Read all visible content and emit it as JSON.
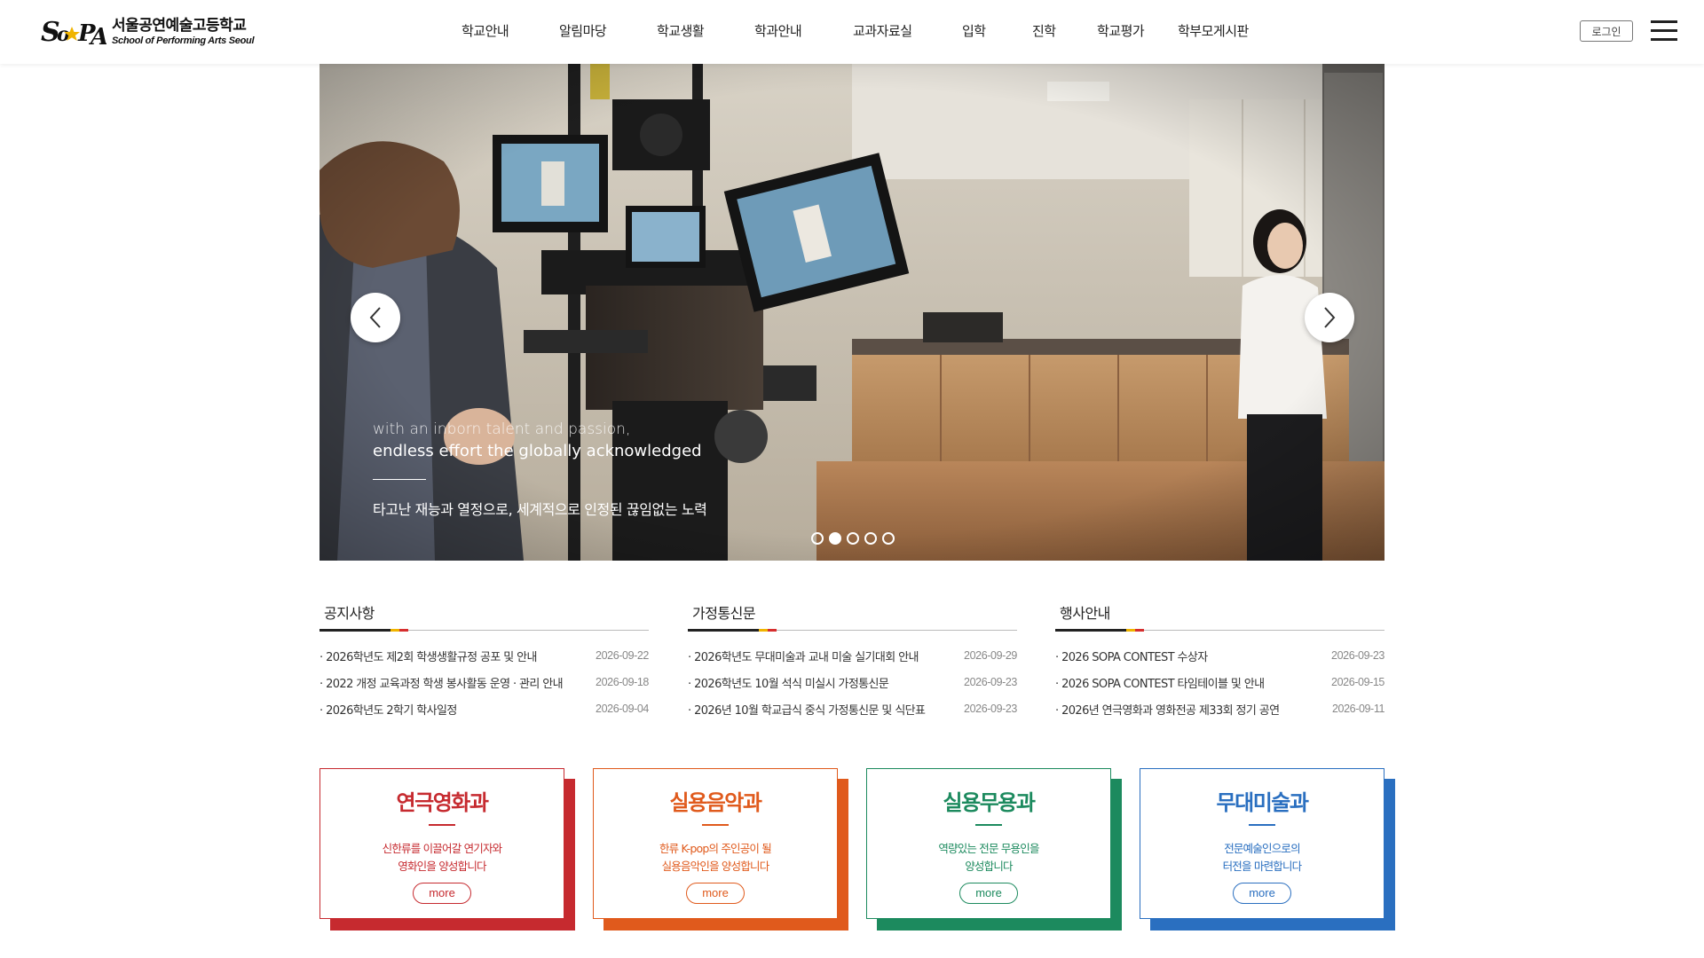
{
  "header": {
    "logo_ko": "서울공연예술고등학교",
    "logo_en": "School of Performing Arts Seoul",
    "nav": [
      {
        "label": "학교안내"
      },
      {
        "label": "알림마당"
      },
      {
        "label": "학교생활"
      },
      {
        "label": "학과안내"
      },
      {
        "label": "교과자료실"
      },
      {
        "label": "입학"
      },
      {
        "label": "진학"
      },
      {
        "label": "학교평가"
      },
      {
        "label": "학부모게시판"
      }
    ],
    "login_label": "로그인",
    "menu_icon": "hamburger-menu-icon"
  },
  "hero": {
    "line_en_1": "with an inborn talent and passion,",
    "line_en_2": "endless effort the globally acknowledged",
    "line_ko": "타고난 재능과 열정으로, 세계적으로 인정된 끊임없는 노력",
    "prev_icon": "chevron-left-icon",
    "next_icon": "chevron-right-icon",
    "slide_count": 5,
    "active_slide": 2
  },
  "boards": [
    {
      "title": "공지사항",
      "items": [
        {
          "title": "· 2026학년도 제2회 학생생활규정 공포 및 안내",
          "date": "2026-09-22"
        },
        {
          "title": "· 2022 개정 교육과정 학생 봉사활동 운영 · 관리 안내",
          "date": "2026-09-18"
        },
        {
          "title": "· 2026학년도 2학기 학사일정",
          "date": "2026-09-04"
        }
      ]
    },
    {
      "title": "가정통신문",
      "items": [
        {
          "title": "· 2026학년도 무대미술과 교내 미술 실기대회 안내",
          "date": "2026-09-29"
        },
        {
          "title": "· 2026학년도 10월 석식 미실시 가정통신문",
          "date": "2026-09-23"
        },
        {
          "title": "· 2026년 10월 학교급식 중식 가정통신문 및 식단표",
          "date": "2026-09-23"
        }
      ]
    },
    {
      "title": "행사안내",
      "items": [
        {
          "title": "· 2026 SOPA CONTEST 수상자",
          "date": "2026-09-23"
        },
        {
          "title": "· 2026 SOPA CONTEST 타임테이블 및 안내",
          "date": "2026-09-15"
        },
        {
          "title": " · 2026년 연극영화과 영화전공 제33회 정기 공연",
          "date": "2026-09-11"
        }
      ]
    }
  ],
  "departments": [
    {
      "name": "연극영화과",
      "desc1": "신한류를 이끌어갈 연기자와",
      "desc2": "영화인을 양성합니다",
      "more": "more",
      "color": "#c62a2f"
    },
    {
      "name": "실용음악과",
      "desc1": "한류 K-pop의 주인공이 될",
      "desc2": "실용음악인을 양성합니다",
      "more": "more",
      "color": "#e05a1c"
    },
    {
      "name": "실용무용과",
      "desc1": "역량있는 전문 무용인을",
      "desc2": "양성합니다",
      "more": "more",
      "color": "#1c8a5e"
    },
    {
      "name": "무대미술과",
      "desc1": "전문예술인으로의",
      "desc2": "터전을 마련합니다",
      "more": "more",
      "color": "#2a6fc0"
    }
  ],
  "colors": {
    "accent_yellow": "#f0b400",
    "accent_red": "#d62e2e",
    "text_dark": "#222222"
  }
}
